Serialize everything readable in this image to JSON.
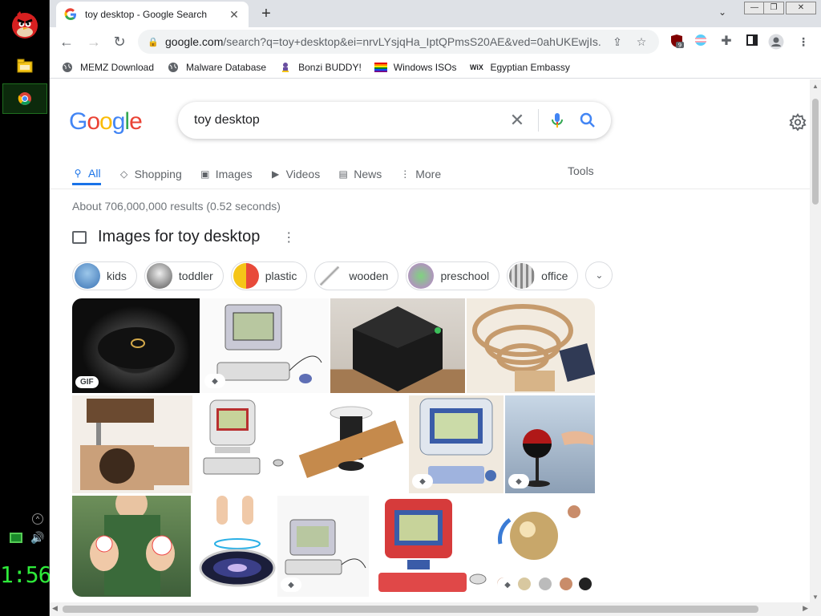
{
  "taskbar": {
    "clock": "1:56",
    "apps": [
      "angry-bird-app",
      "folder-app",
      "chrome-app"
    ]
  },
  "browser": {
    "tab": {
      "title": "toy desktop - Google Search"
    },
    "window_controls": {
      "minimize": "—",
      "restore": "❐",
      "close": "✕"
    },
    "address_bar": {
      "host": "google.com",
      "path": "/search?q=toy+desktop&ei=nrvLYsjqHa_IptQPmsS20AE&ved=0ahUKEwjIs..."
    },
    "extension_badge": "9",
    "bookmarks": [
      {
        "label": "MEMZ Download",
        "icon": "globe-icon"
      },
      {
        "label": "Malware Database",
        "icon": "globe-icon"
      },
      {
        "label": "Bonzi BUDDY!",
        "icon": "bonzi-icon"
      },
      {
        "label": "Windows ISOs",
        "icon": "rainbow-flag-icon"
      },
      {
        "label": "Egyptian Embassy",
        "icon": "wix-icon"
      }
    ]
  },
  "search": {
    "logo": [
      "G",
      "o",
      "o",
      "g",
      "l",
      "e"
    ],
    "query": "toy desktop",
    "tabs": [
      {
        "label": "All",
        "icon": "search-icon",
        "active": true
      },
      {
        "label": "Shopping",
        "icon": "tag-icon"
      },
      {
        "label": "Images",
        "icon": "image-icon"
      },
      {
        "label": "Videos",
        "icon": "play-icon"
      },
      {
        "label": "News",
        "icon": "news-icon"
      },
      {
        "label": "More",
        "icon": "more-icon"
      }
    ],
    "tools_label": "Tools",
    "stats": "About 706,000,000 results (0.52 seconds)",
    "images_heading": "Images for toy desktop",
    "chips": [
      "kids",
      "toddler",
      "plastic",
      "wooden",
      "preschool",
      "office"
    ],
    "gif_badge": "GIF"
  },
  "colors": {
    "google_blue": "#4285F4",
    "google_red": "#EA4335",
    "google_yellow": "#FBBC05",
    "google_green": "#34A853",
    "active_tab": "#1a73e8",
    "clock_green": "#2eea3a"
  }
}
